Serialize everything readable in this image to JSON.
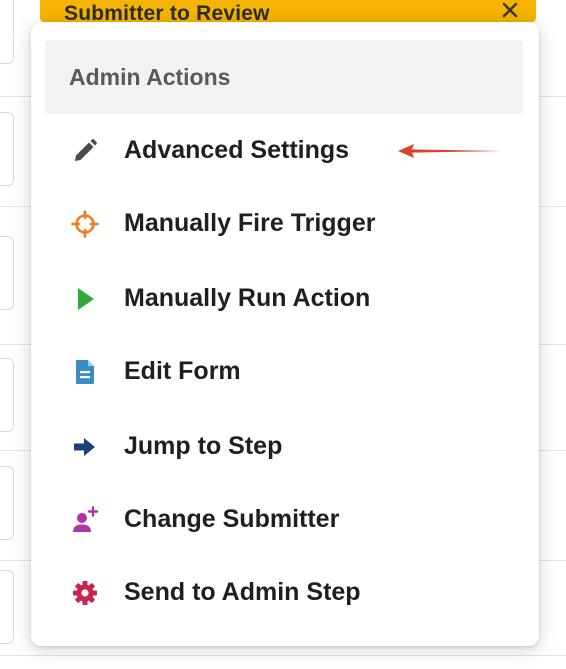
{
  "banner": {
    "title": "Submitter to Review"
  },
  "menu": {
    "header": "Admin Actions",
    "items": [
      {
        "label": "Advanced Settings",
        "icon": "pencil-icon",
        "color": "#4a4a4f"
      },
      {
        "label": "Manually Fire Trigger",
        "icon": "crosshair-icon",
        "color": "#f07c1e"
      },
      {
        "label": "Manually Run Action",
        "icon": "play-icon",
        "color": "#2eaa3f"
      },
      {
        "label": "Edit Form",
        "icon": "document-icon",
        "color": "#3a8dc4"
      },
      {
        "label": "Jump to Step",
        "icon": "arrow-right-icon",
        "color": "#1d3f7a"
      },
      {
        "label": "Change Submitter",
        "icon": "user-plus-icon",
        "color": "#b033a8"
      },
      {
        "label": "Send to Admin Step",
        "icon": "gear-icon",
        "color": "#c8234f"
      }
    ]
  },
  "annotation": {
    "arrow_color": "#d9452b"
  },
  "colors": {
    "banner": "#f4b400"
  }
}
